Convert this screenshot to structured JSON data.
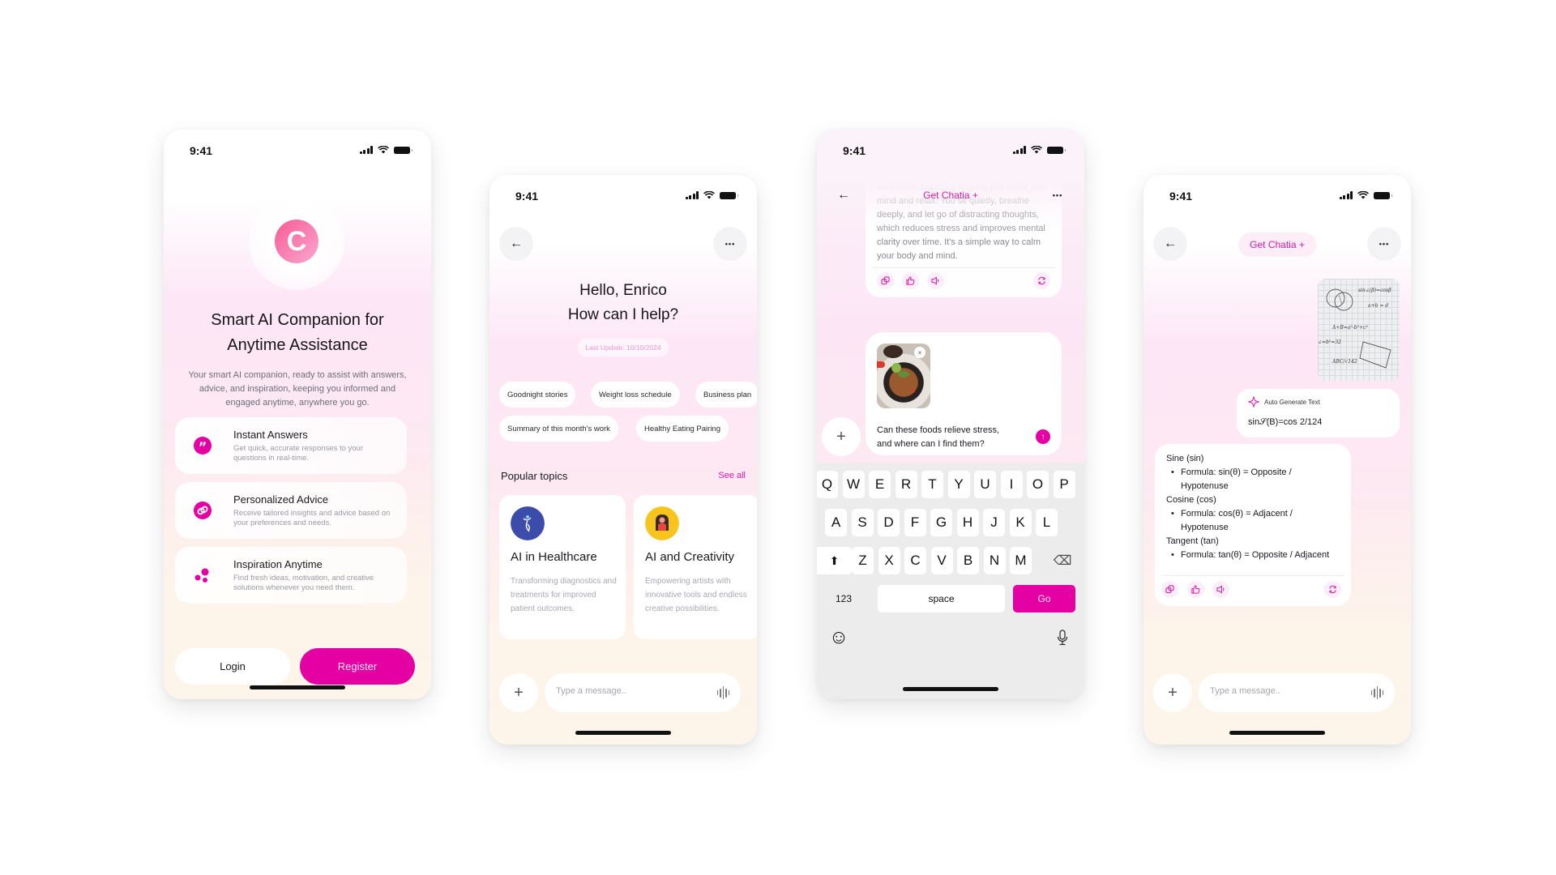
{
  "status_time": "9:41",
  "colors": {
    "accent": "#e500a4",
    "accent_text": "#d61aa8",
    "logo_from": "#f65a94",
    "logo_to": "#fba8cf"
  },
  "onboarding": {
    "logo_letter": "C",
    "title_line1": "Smart AI Companion for",
    "title_line2": "Anytime Assistance",
    "subtitle": "Your smart AI companion, ready to assist with answers, advice, and inspiration, keeping you informed and engaged anytime, anywhere you go.",
    "features": [
      {
        "icon": "quote-icon",
        "title": "Instant Answers",
        "desc": "Get quick, accurate responses to your questions in real-time."
      },
      {
        "icon": "link-icon",
        "title": "Personalized Advice",
        "desc": "Receive tailored insights and advice based on your preferences and needs."
      },
      {
        "icon": "dots-icon",
        "title": "Inspiration Anytime",
        "desc": "Find fresh ideas, motivation, and creative solutions whenever you need them."
      }
    ],
    "login_label": "Login",
    "register_label": "Register"
  },
  "home": {
    "back_icon": "←",
    "more_icon": "•••",
    "greeting_line1": "Hello, Enrico",
    "greeting_line2": "How can I help?",
    "last_update": "Last Update: 10/10/2024",
    "chips": [
      "Goodnight stories",
      "Weight loss schedule",
      "Business plan",
      "Summary of this month's work",
      "Healthy Eating Pairing"
    ],
    "popular_title": "Popular topics",
    "see_all": "See all",
    "topics": [
      {
        "title": "AI in Healthcare",
        "desc": "Transforming diagnostics and treatments for improved patient outcomes."
      },
      {
        "title": "AI and Creativity",
        "desc": "Empowering artists with innovative tools and endless creative possibilities."
      }
    ],
    "input_placeholder": "Type a message..",
    "plus_icon": "+"
  },
  "chat_image": {
    "back_icon": "←",
    "more_icon": "•••",
    "get_plus": "Get Chatia +",
    "previous_answer": "Meditation works by helping you focus your mind and relax. You sit quietly, breathe deeply, and let go of distracting thoughts, which reduces stress and improves mental clarity over time. It's a simple way to calm your body and mind.",
    "compose_text": "Can these foods relieve stress, and where can I find them?",
    "remove_icon": "×",
    "send_icon": "↑",
    "plus_icon": "+",
    "keyboard": {
      "row1": [
        "Q",
        "W",
        "E",
        "R",
        "T",
        "Y",
        "U",
        "I",
        "O",
        "P"
      ],
      "row2": [
        "A",
        "S",
        "D",
        "F",
        "G",
        "H",
        "J",
        "K",
        "L"
      ],
      "row3": [
        "Z",
        "X",
        "C",
        "V",
        "B",
        "N",
        "M"
      ],
      "shift_icon": "⬆",
      "backspace_icon": "⌫",
      "numbers_label": "123",
      "space_label": "space",
      "go_label": "Go",
      "emoji_icon": "☺",
      "mic_icon": "🎙"
    }
  },
  "chat_math": {
    "back_icon": "←",
    "more_icon": "•••",
    "get_plus": "Get Chatia +",
    "auto_generate_label": "Auto Generate Text",
    "recognized_text": "sin𝒮(B)=cos 2/124",
    "answer_lines": [
      {
        "text": "Sine (sin)",
        "indent": false,
        "bullet": false
      },
      {
        "text": "Formula: sin(θ) = Opposite /",
        "indent": true,
        "bullet": true
      },
      {
        "text": "Hypotenuse",
        "indent": true,
        "bullet": false
      },
      {
        "text": "Cosine (cos)",
        "indent": false,
        "bullet": false
      },
      {
        "text": "Formula: cos(θ) = Adjacent /",
        "indent": true,
        "bullet": true
      },
      {
        "text": "Hypotenuse",
        "indent": true,
        "bullet": false
      },
      {
        "text": "Tangent (tan)",
        "indent": false,
        "bullet": false
      },
      {
        "text": "Formula: tan(θ) = Opposite / Adjacent",
        "indent": true,
        "bullet": true
      }
    ],
    "input_placeholder": "Type a message..",
    "plus_icon": "+"
  }
}
